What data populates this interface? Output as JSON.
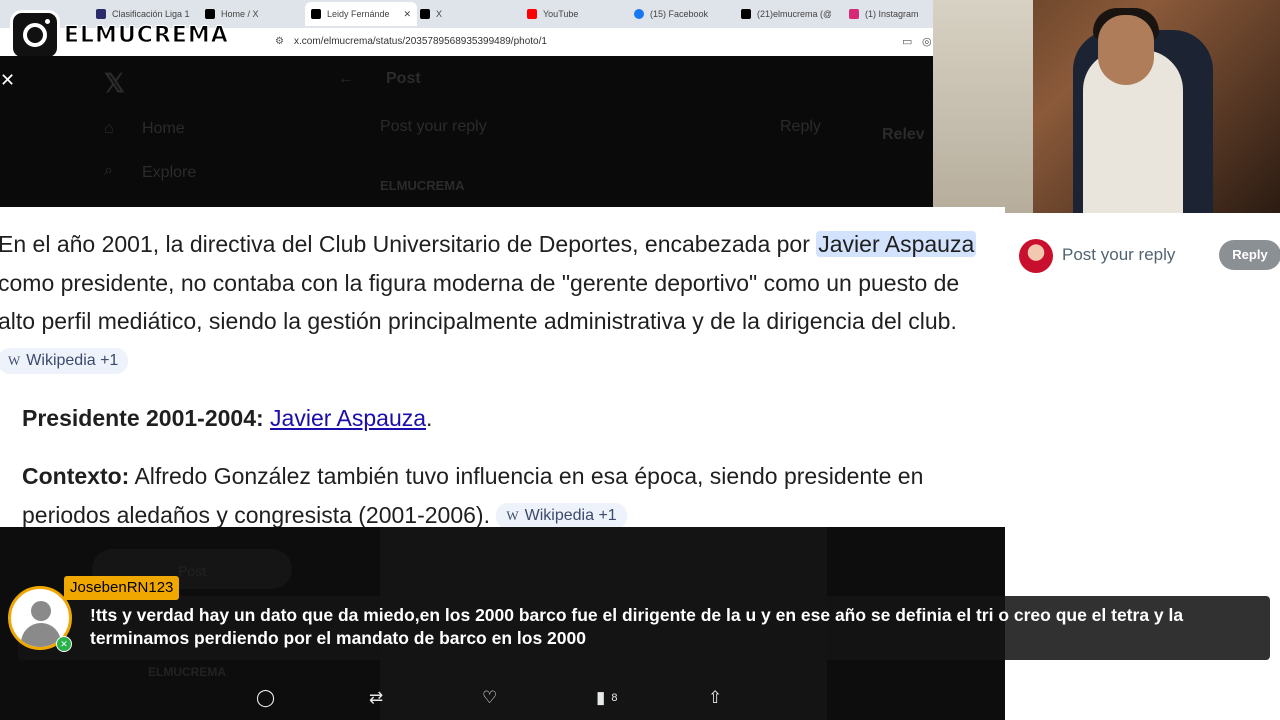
{
  "browser": {
    "tabs": [
      {
        "label": "Clasificación Liga 1",
        "icon_color": "#2b2b6b"
      },
      {
        "label": "Home / X",
        "icon_color": "#000000"
      },
      {
        "label": "Leidy Fernánde",
        "icon_color": "#000000",
        "active": true
      },
      {
        "label": "X",
        "icon_color": "#000000"
      },
      {
        "label": "YouTube",
        "icon_color": "#ff0000"
      },
      {
        "label": "(15) Facebook",
        "icon_color": "#1877f2"
      },
      {
        "label": "(21)elmucrema (@e",
        "icon_color": "#000000"
      },
      {
        "label": "(1) Instagram",
        "icon_color": "#d62976"
      }
    ],
    "url": "x.com/elmucrema/status/2035789568935399489/photo/1"
  },
  "logo": {
    "text": "ELMUCREMA"
  },
  "x_background": {
    "nav_home": "Home",
    "nav_explore": "Explore",
    "post_header": "Post",
    "reply_placeholder": "Post your reply",
    "reply_label": "Reply",
    "relevant": "Relev",
    "author": "ELMUCREMA",
    "post_button": "Post"
  },
  "article": {
    "p1_a": "En el año 2001, la directiva del Club Universitario de Deportes, encabezada por ",
    "p1_hl": "Javier Aspauza",
    "p1_b": " como presidente, no contaba con la figura moderna de \"gerente deportivo\" como un puesto de alto perfil mediático, siendo la gestión principalmente administrativa y de la dirigencia del club.",
    "chip1": "Wikipedia +1",
    "presidente_label": "Presidente 2001-2004:",
    "presidente_link": "Javier Aspauza",
    "presidente_end": ".",
    "contexto_label": "Contexto:",
    "contexto_text": " Alfredo González también tuvo influencia en esa época, siendo presidente en periodos aledaños y congresista (2001-2006).",
    "chip2": "Wikipedia +1",
    "chip_icon": "W"
  },
  "reply": {
    "placeholder": "Post your reply",
    "button": "Reply"
  },
  "actions": {
    "views_count": "8"
  },
  "chat": {
    "username": "JosebenRN123",
    "message": "!tts y verdad hay un dato que da miedo,en los 2000 barco fue el dirigente de la u y en ese año se definia el tri o creo que el tetra y la terminamos perdiendo por el mandato de barco en los 2000"
  }
}
